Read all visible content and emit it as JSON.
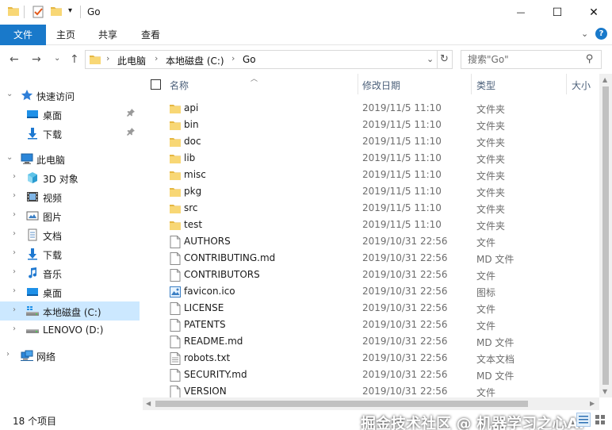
{
  "window": {
    "title": "Go",
    "minimize_glyph": "—",
    "maximize_glyph": "☐",
    "close_glyph": "✕",
    "quick_access_dropdown_glyph": "▾"
  },
  "ribbon": {
    "tabs": [
      {
        "label": "文件"
      },
      {
        "label": "主页"
      },
      {
        "label": "共享"
      },
      {
        "label": "查看"
      }
    ],
    "collapse_glyph": "⌄",
    "help_glyph": "?"
  },
  "address": {
    "crumbs": [
      "此电脑",
      "本地磁盘 (C:)",
      "Go"
    ],
    "separator": "›",
    "back_glyph": "←",
    "forward_glyph": "→",
    "recent_glyph": "⌄",
    "up_glyph": "↑",
    "dropdown_glyph": "⌄",
    "refresh_glyph": "↻"
  },
  "search": {
    "placeholder": "搜索\"Go\"",
    "search_glyph": "⚲"
  },
  "nav": {
    "items": [
      {
        "label": "快速访问",
        "icon": "star-icon",
        "expand": "⌄",
        "pinned": false
      },
      {
        "label": "桌面",
        "icon": "desktop-icon",
        "expand": "",
        "pinned": true
      },
      {
        "label": "下载",
        "icon": "download-icon",
        "expand": "",
        "pinned": true
      },
      {
        "label": "此电脑",
        "icon": "computer-icon",
        "expand": "⌄",
        "pinned": false
      },
      {
        "label": "3D 对象",
        "icon": "cube-3d-icon",
        "expand": "›",
        "pinned": false
      },
      {
        "label": "视频",
        "icon": "video-icon",
        "expand": "›",
        "pinned": false
      },
      {
        "label": "图片",
        "icon": "pictures-icon",
        "expand": "›",
        "pinned": false
      },
      {
        "label": "文档",
        "icon": "documents-icon",
        "expand": "›",
        "pinned": false
      },
      {
        "label": "下载",
        "icon": "download-icon",
        "expand": "›",
        "pinned": false
      },
      {
        "label": "音乐",
        "icon": "music-icon",
        "expand": "›",
        "pinned": false
      },
      {
        "label": "桌面",
        "icon": "desktop-icon",
        "expand": "›",
        "pinned": false
      },
      {
        "label": "本地磁盘 (C:)",
        "icon": "drive-c-icon",
        "expand": "›",
        "pinned": false,
        "selected": true
      },
      {
        "label": "LENOVO (D:)",
        "icon": "drive-d-icon",
        "expand": "›",
        "pinned": false
      },
      {
        "label": "网络",
        "icon": "network-icon",
        "expand": "›",
        "pinned": false
      }
    ],
    "pin_glyph": "📌"
  },
  "columns": {
    "name": "名称",
    "date": "修改日期",
    "type": "类型",
    "size": "大小",
    "sort_glyph": "︿"
  },
  "files": [
    {
      "name": "api",
      "date": "2019/11/5 11:10",
      "type": "文件夹",
      "kind": "folder"
    },
    {
      "name": "bin",
      "date": "2019/11/5 11:10",
      "type": "文件夹",
      "kind": "folder"
    },
    {
      "name": "doc",
      "date": "2019/11/5 11:10",
      "type": "文件夹",
      "kind": "folder"
    },
    {
      "name": "lib",
      "date": "2019/11/5 11:10",
      "type": "文件夹",
      "kind": "folder"
    },
    {
      "name": "misc",
      "date": "2019/11/5 11:10",
      "type": "文件夹",
      "kind": "folder"
    },
    {
      "name": "pkg",
      "date": "2019/11/5 11:10",
      "type": "文件夹",
      "kind": "folder"
    },
    {
      "name": "src",
      "date": "2019/11/5 11:10",
      "type": "文件夹",
      "kind": "folder"
    },
    {
      "name": "test",
      "date": "2019/11/5 11:10",
      "type": "文件夹",
      "kind": "folder"
    },
    {
      "name": "AUTHORS",
      "date": "2019/10/31 22:56",
      "type": "文件",
      "kind": "file"
    },
    {
      "name": "CONTRIBUTING.md",
      "date": "2019/10/31 22:56",
      "type": "MD 文件",
      "kind": "file"
    },
    {
      "name": "CONTRIBUTORS",
      "date": "2019/10/31 22:56",
      "type": "文件",
      "kind": "file"
    },
    {
      "name": "favicon.ico",
      "date": "2019/10/31 22:56",
      "type": "图标",
      "kind": "image"
    },
    {
      "name": "LICENSE",
      "date": "2019/10/31 22:56",
      "type": "文件",
      "kind": "file"
    },
    {
      "name": "PATENTS",
      "date": "2019/10/31 22:56",
      "type": "文件",
      "kind": "file"
    },
    {
      "name": "README.md",
      "date": "2019/10/31 22:56",
      "type": "MD 文件",
      "kind": "file"
    },
    {
      "name": "robots.txt",
      "date": "2019/10/31 22:56",
      "type": "文本文档",
      "kind": "text"
    },
    {
      "name": "SECURITY.md",
      "date": "2019/10/31 22:56",
      "type": "MD 文件",
      "kind": "file"
    },
    {
      "name": "VERSION",
      "date": "2019/10/31 22:56",
      "type": "文件",
      "kind": "file"
    }
  ],
  "scroll_glyphs": {
    "up": "▲",
    "down": "▼",
    "left": "◀",
    "right": "▶"
  },
  "status": {
    "item_count": "18 个项目"
  },
  "watermark": "掘金技术社区 @ 机器学习之心AI",
  "colors": {
    "accent": "#1979ca",
    "selected": "#cce8ff",
    "folder": "#f8d775",
    "folder_dark": "#e5b743"
  }
}
